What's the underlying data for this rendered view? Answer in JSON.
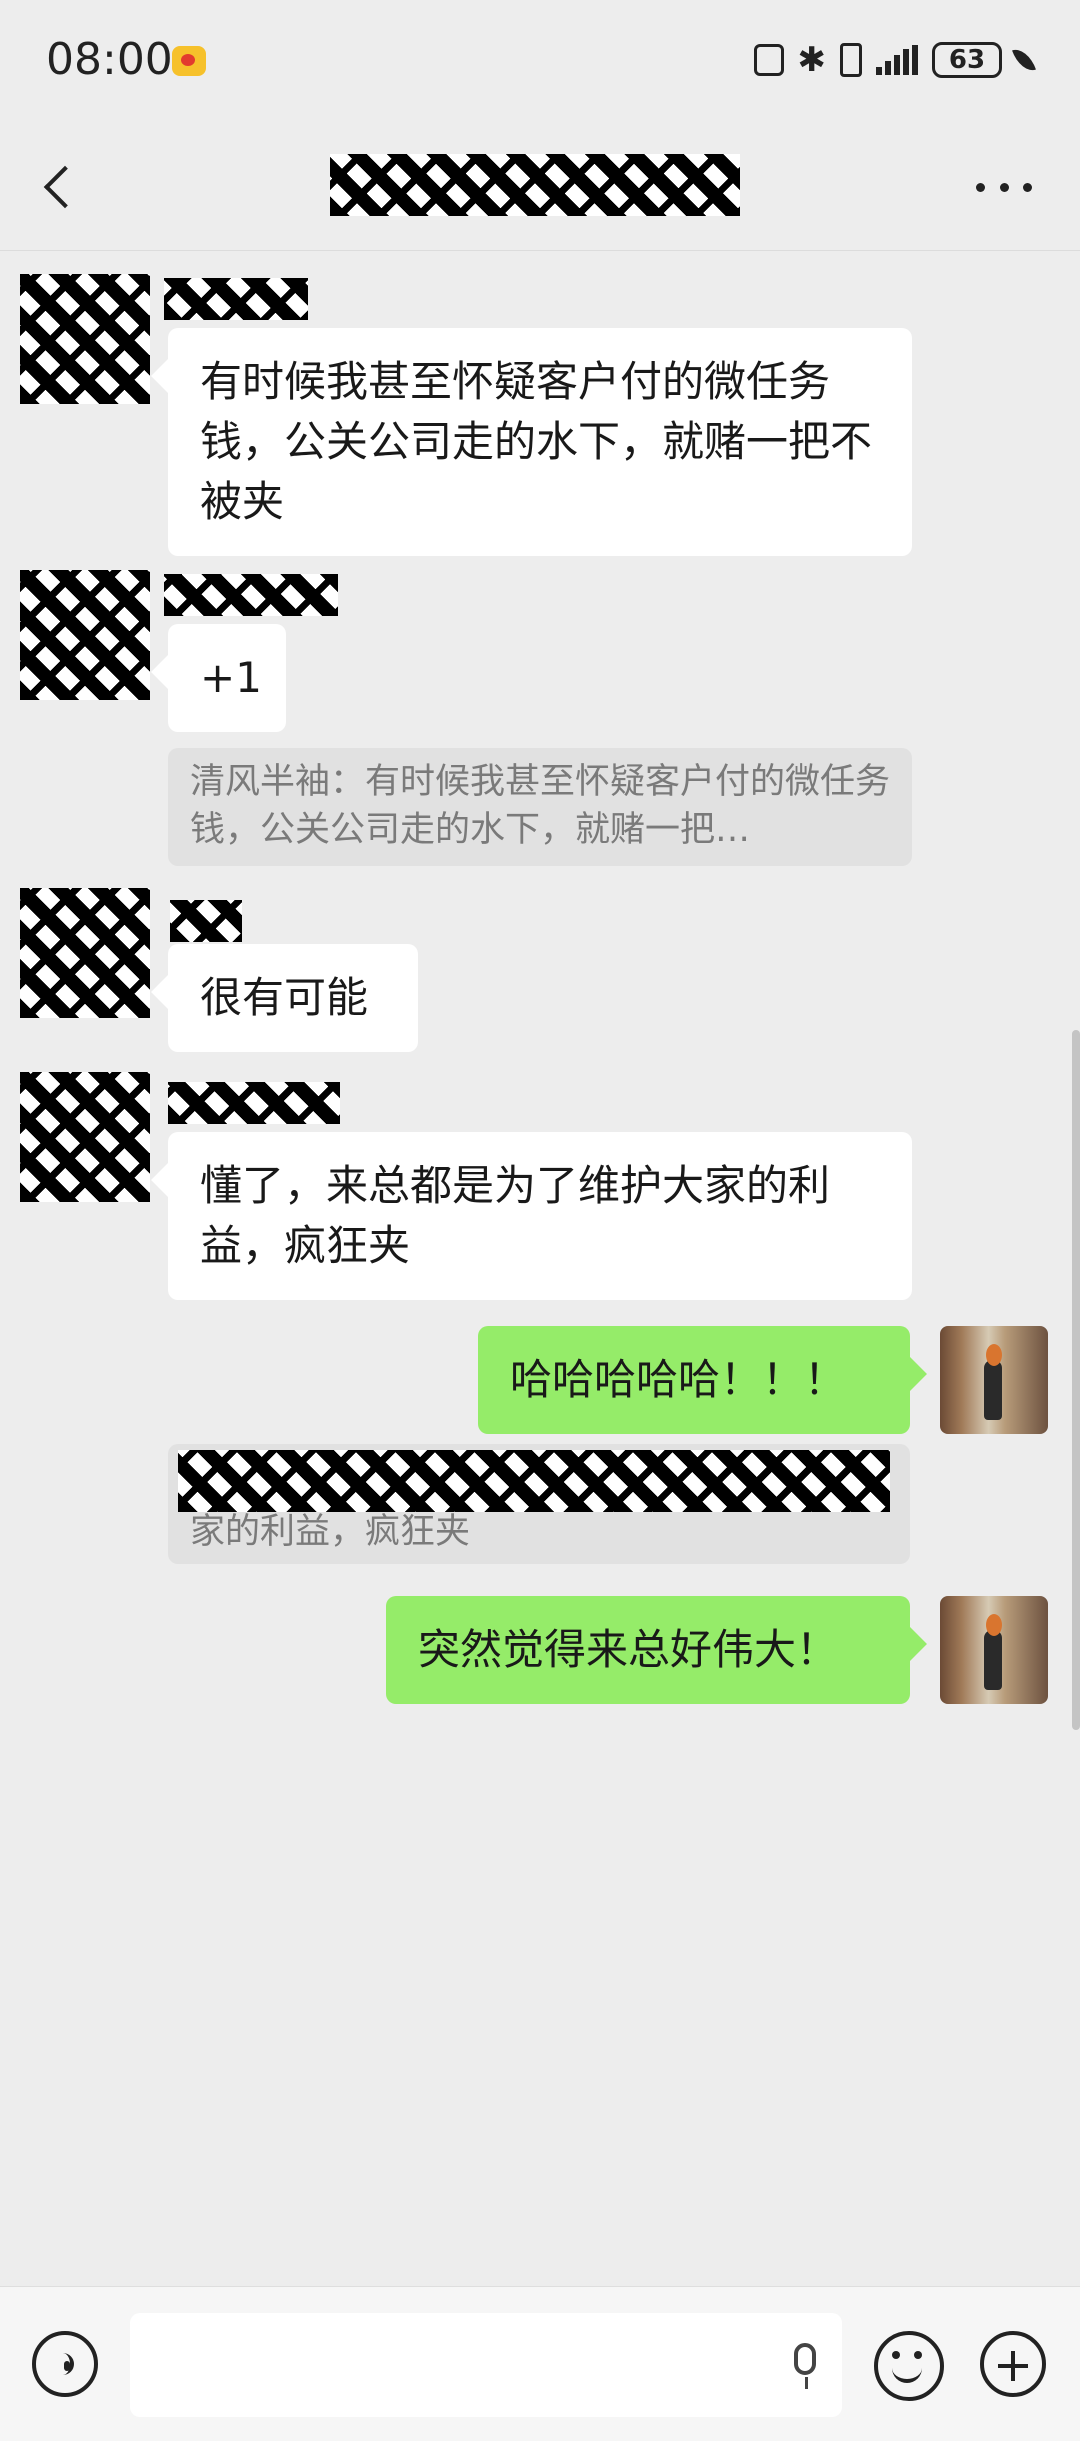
{
  "status_bar": {
    "time": "08:00",
    "battery": "63"
  },
  "header": {
    "title": "[redacted chat title]"
  },
  "messages": [
    {
      "sender": "other",
      "text": "有时候我甚至怀疑客户付的微任务钱，公关公司走的水下，就赌一把不被夹"
    },
    {
      "sender": "other",
      "text": "+1",
      "quote": "清风半袖：有时候我甚至怀疑客户付的微任务钱，公关公司走的水下，就赌一把…"
    },
    {
      "sender": "other",
      "text": "很有可能"
    },
    {
      "sender": "other",
      "text": "懂了，来总都是为了维护大家的利益，疯狂夹"
    },
    {
      "sender": "me",
      "text": "哈哈哈哈哈！！！",
      "quote": "家的利益，疯狂夹"
    },
    {
      "sender": "me",
      "text": "突然觉得来总好伟大！"
    }
  ],
  "colors": {
    "background": "#ededed",
    "my_bubble": "#95ec69",
    "their_bubble": "#ffffff",
    "quote_bg": "#e1e1e1"
  },
  "icons": [
    "back-icon",
    "more-icon",
    "voice-icon",
    "mic-icon",
    "emoji-icon",
    "plus-icon"
  ]
}
